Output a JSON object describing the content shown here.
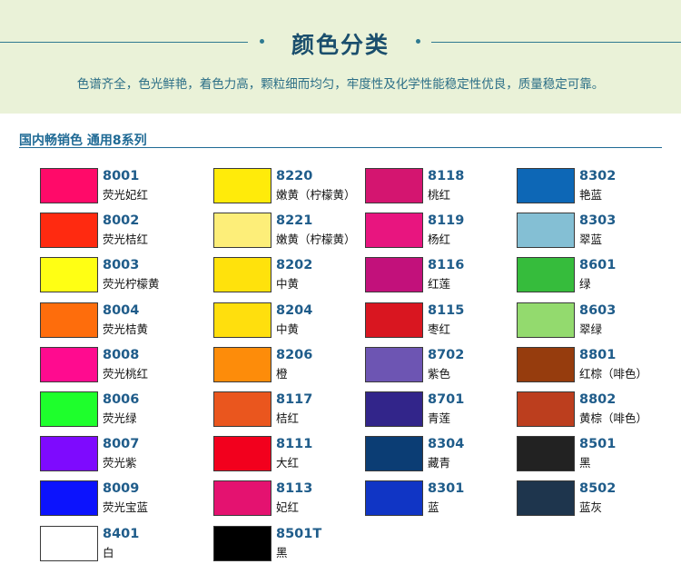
{
  "header": {
    "title": "颜色分类",
    "subtitle": "色谱齐全，色光鲜艳，着色力高，颗粒细而均匀，牢度性及化学性能稳定性优良，质量稳定可靠。"
  },
  "section": {
    "title": "国内畅销色 通用8系列"
  },
  "columns": [
    {
      "items": [
        {
          "code": "8001",
          "name": "荧光妃红",
          "color": "#ff0a69"
        },
        {
          "code": "8002",
          "name": "荧光桔红",
          "color": "#ff2a10"
        },
        {
          "code": "8003",
          "name": "荧光柠檬黄",
          "color": "#ffff14"
        },
        {
          "code": "8004",
          "name": "荧光桔黄",
          "color": "#fe6d0c"
        },
        {
          "code": "8008",
          "name": "荧光桃红",
          "color": "#ff0b8f"
        },
        {
          "code": "8006",
          "name": "荧光绿",
          "color": "#1eff2c"
        },
        {
          "code": "8007",
          "name": "荧光紫",
          "color": "#7e0afe"
        },
        {
          "code": "8009",
          "name": "荧光宝蓝",
          "color": "#0c13fd"
        },
        {
          "code": "8401",
          "name": "白",
          "color": "#ffffff"
        }
      ]
    },
    {
      "items": [
        {
          "code": "8220",
          "name": "嫩黄（柠檬黄）",
          "color": "#ffeb0a"
        },
        {
          "code": "8221",
          "name": "嫩黄（柠檬黄）",
          "color": "#fdee79"
        },
        {
          "code": "8202",
          "name": "中黄",
          "color": "#ffe20c"
        },
        {
          "code": "8204",
          "name": "中黄",
          "color": "#ffdf0d"
        },
        {
          "code": "8206",
          "name": "橙",
          "color": "#fd8c0a"
        },
        {
          "code": "8117",
          "name": "桔红",
          "color": "#ea561e"
        },
        {
          "code": "8111",
          "name": "大红",
          "color": "#f2001d"
        },
        {
          "code": "8113",
          "name": "妃红",
          "color": "#e41270"
        },
        {
          "code": "8501T",
          "name": "黑",
          "color": "#000000"
        }
      ]
    },
    {
      "items": [
        {
          "code": "8118",
          "name": "桃红",
          "color": "#d41570"
        },
        {
          "code": "8119",
          "name": "杨红",
          "color": "#e8157f"
        },
        {
          "code": "8116",
          "name": "红莲",
          "color": "#c2117b"
        },
        {
          "code": "8115",
          "name": "枣红",
          "color": "#d91620"
        },
        {
          "code": "8702",
          "name": "紫色",
          "color": "#6d55b3"
        },
        {
          "code": "8701",
          "name": "青莲",
          "color": "#32258a"
        },
        {
          "code": "8304",
          "name": "藏青",
          "color": "#0b3d74"
        },
        {
          "code": "8301",
          "name": "蓝",
          "color": "#1035c5"
        }
      ]
    },
    {
      "items": [
        {
          "code": "8302",
          "name": "艳蓝",
          "color": "#0d67b6"
        },
        {
          "code": "8303",
          "name": "翠蓝",
          "color": "#84bfd4"
        },
        {
          "code": "8601",
          "name": "绿",
          "color": "#36bc3c"
        },
        {
          "code": "8603",
          "name": "翠绿",
          "color": "#93da6e"
        },
        {
          "code": "8801",
          "name": "红棕（啡色）",
          "color": "#963c0d"
        },
        {
          "code": "8802",
          "name": "黄棕（啡色）",
          "color": "#bc3e1e"
        },
        {
          "code": "8501",
          "name": "黑",
          "color": "#222222"
        },
        {
          "code": "8502",
          "name": "蓝灰",
          "color": "#1e354d"
        }
      ]
    }
  ]
}
